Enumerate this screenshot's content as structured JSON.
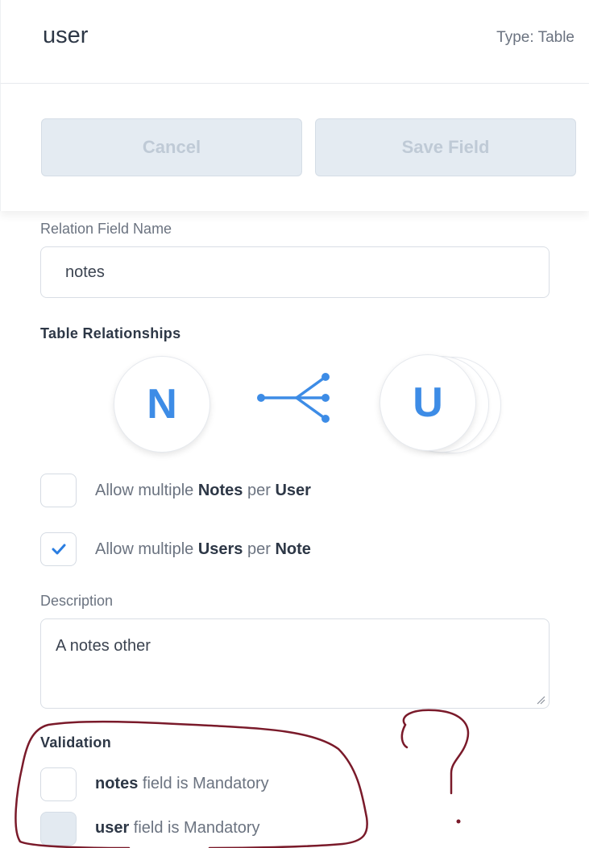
{
  "header": {
    "title": "user",
    "type_label": "Type: Table"
  },
  "actions": {
    "cancel_label": "Cancel",
    "save_label": "Save Field"
  },
  "relation_field": {
    "label": "Relation Field Name",
    "value": "notes"
  },
  "relationships": {
    "heading": "Table Relationships",
    "left_letter": "N",
    "right_letter": "U",
    "accent_color": "#3d8ce6",
    "icon": "one-to-many-icon"
  },
  "options": [
    {
      "prefix": "Allow multiple ",
      "entity": "Notes",
      "mid": " per ",
      "target": "User",
      "checked": false
    },
    {
      "prefix": "Allow multiple ",
      "entity": "Users",
      "mid": " per ",
      "target": "Note",
      "checked": true
    }
  ],
  "description": {
    "label": "Description",
    "value": "A notes other"
  },
  "validation": {
    "heading": "Validation",
    "items": [
      {
        "field": "notes",
        "suffix": " field is Mandatory",
        "checked": false,
        "disabled": false
      },
      {
        "field": "user",
        "suffix": " field is Mandatory",
        "checked": false,
        "disabled": true
      }
    ]
  },
  "annotation_color": "#7a1a2a"
}
